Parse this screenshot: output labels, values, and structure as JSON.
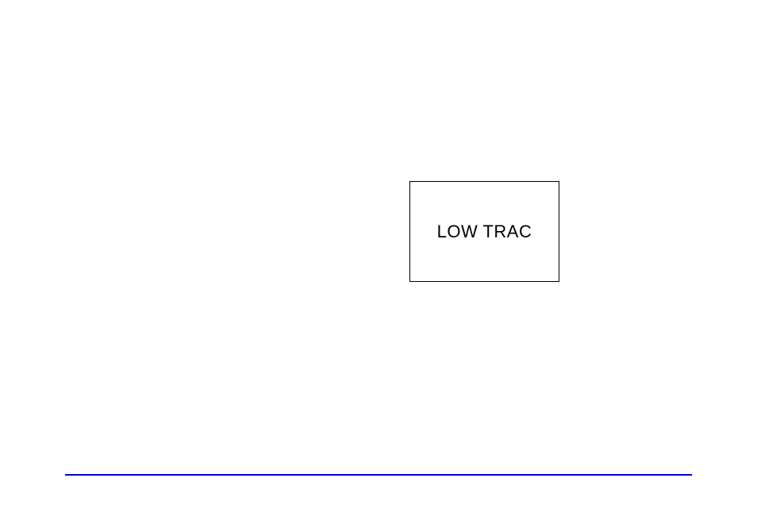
{
  "indicator": {
    "label": "LOW TRAC"
  }
}
